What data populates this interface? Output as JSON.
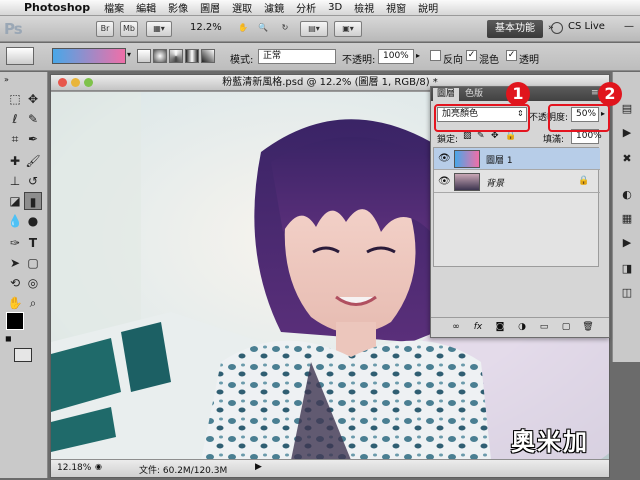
{
  "menubar": {
    "apple": "",
    "app_name": "Photoshop",
    "items": [
      "檔案",
      "編輯",
      "影像",
      "圖層",
      "選取",
      "濾鏡",
      "分析",
      "3D",
      "檢視",
      "視窗",
      "說明"
    ]
  },
  "appbar": {
    "logo": "Ps",
    "br": "Br",
    "mb": "Mb",
    "zoom": "12.2%",
    "workspace_label": "基本功能",
    "cs_live_label": "CS Live"
  },
  "options": {
    "mode_label": "模式:",
    "mode_value": "正常",
    "opacity_label": "不透明:",
    "opacity_value": "100%",
    "reverse_label": "反向",
    "dither_label": "混色",
    "transparency_label": "透明"
  },
  "document": {
    "title": "粉藍清新風格.psd @ 12.2% (圖層 1, RGB/8) *",
    "zoom_status": "12.18%",
    "file_status": "文件: 60.2M/120.3M"
  },
  "layers_panel": {
    "tab_layers": "圖層",
    "tab_channels": "色版",
    "blend_mode": "加亮顏色",
    "opacity_label": "不透明度:",
    "opacity_value": "50%",
    "lock_label": "鎖定:",
    "fill_label": "填滿:",
    "fill_value": "100%",
    "layers": [
      {
        "name": "圖層 1",
        "selected": true
      },
      {
        "name": "背景",
        "selected": false
      }
    ]
  },
  "callouts": {
    "one": "1",
    "two": "2"
  },
  "watermark": "奧米加",
  "colors": {
    "callout_red": "#e0151d",
    "gradient_start": "#48a7e8",
    "gradient_end": "#f06fa8",
    "selected_layer": "#b7cde8"
  }
}
